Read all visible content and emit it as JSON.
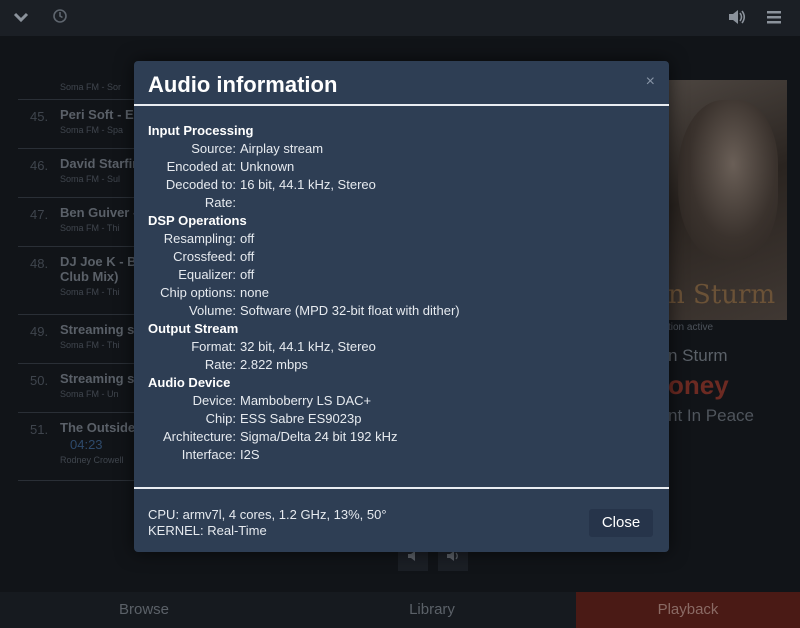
{
  "topbar": {
    "icons": [
      "chevron-down-icon",
      "clock-icon",
      "volume-icon",
      "menu-icon"
    ]
  },
  "playlist": {
    "items": [
      {
        "num": "",
        "title": "",
        "sub": "Soma FM - Sor"
      },
      {
        "num": "45.",
        "title": "Peri Soft - Ex",
        "sub": "Soma FM - Spa"
      },
      {
        "num": "46.",
        "title": "David Starfir",
        "sub": "Soma FM - Sul"
      },
      {
        "num": "47.",
        "title": "Ben Guiver -",
        "sub": "Soma FM - Thi"
      },
      {
        "num": "48.",
        "title": "DJ Joe K - Bo",
        "title2": "Club Mix)",
        "sub": "Soma FM - Thi"
      },
      {
        "num": "49.",
        "title": "Streaming so",
        "sub": "Soma FM - Thi"
      },
      {
        "num": "50.",
        "title": "Streaming so",
        "sub": "Soma FM - Un"
      },
      {
        "num": "51.",
        "title": "The Outside",
        "time": "04:23",
        "sub": "Rodney Crowell"
      }
    ]
  },
  "playback": {
    "cover_text": "n Sturm",
    "status": "tion active",
    "artist": "n Sturm",
    "title": "oney",
    "album": "nt In Peace"
  },
  "bottomnav": {
    "browse": "Browse",
    "library": "Library",
    "playback": "Playback"
  },
  "modal": {
    "title": "Audio information",
    "close_x": "×",
    "sections": [
      {
        "heading": "Input Processing",
        "rows": [
          {
            "k": "Source:",
            "v": "Airplay stream"
          },
          {
            "k": "Encoded at:",
            "v": "Unknown"
          },
          {
            "k": "Decoded to:",
            "v": "16 bit, 44.1 kHz, Stereo"
          },
          {
            "k": "Rate:",
            "v": ""
          }
        ]
      },
      {
        "heading": "DSP Operations",
        "rows": [
          {
            "k": "Resampling:",
            "v": "off"
          },
          {
            "k": "Crossfeed:",
            "v": "off"
          },
          {
            "k": "Equalizer:",
            "v": "off"
          },
          {
            "k": "Chip options:",
            "v": "none"
          },
          {
            "k": "Volume:",
            "v": "Software (MPD 32-bit float with dither)"
          }
        ]
      },
      {
        "heading": "Output Stream",
        "rows": [
          {
            "k": "Format:",
            "v": "32 bit, 44.1 kHz, Stereo"
          },
          {
            "k": "Rate:",
            "v": "2.822 mbps"
          }
        ]
      },
      {
        "heading": "Audio Device",
        "rows": [
          {
            "k": "Device:",
            "v": "Mamboberry LS DAC+"
          },
          {
            "k": "Chip:",
            "v": "ESS Sabre ES9023p"
          },
          {
            "k": "Architecture:",
            "v": "Sigma/Delta 24 bit 192 kHz"
          },
          {
            "k": "Interface:",
            "v": "I2S"
          }
        ]
      }
    ],
    "footer": {
      "cpu": "CPU: armv7l, 4 cores, 1.2 GHz, 13%, 50°",
      "kernel": "KERNEL: Real-Time",
      "close_label": "Close"
    }
  }
}
